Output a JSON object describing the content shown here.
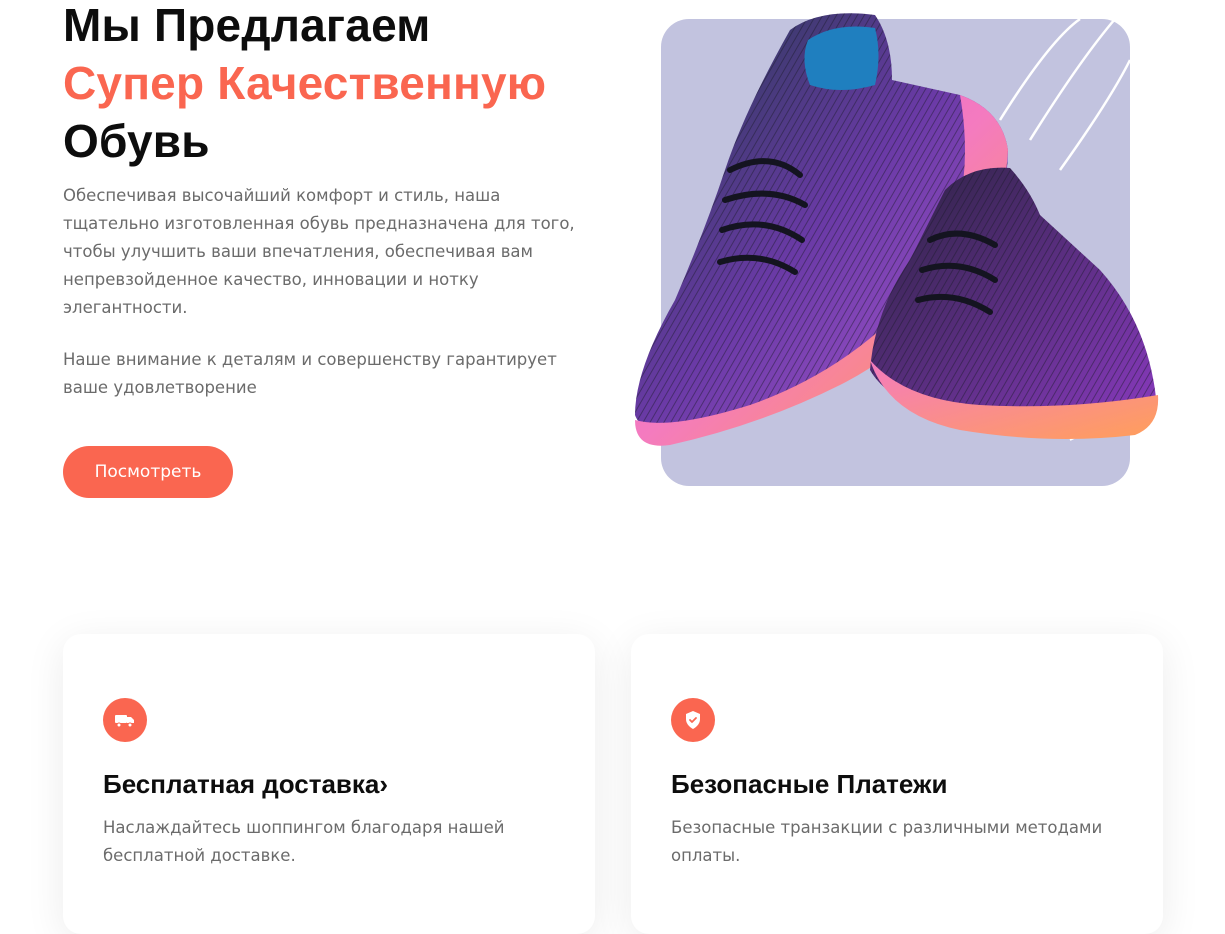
{
  "hero": {
    "title_line1": "Мы Предлагаем",
    "title_line2": "Супер Качественную",
    "title_line3": "Обувь",
    "paragraph1": "Обеспечивая высочайший комфорт и стиль, наша тщательно изготовленная обувь предназначена для того, чтобы улучшить ваши впечатления, обеспечивая вам непревзойденное качество, инновации и нотку элегантности.",
    "paragraph2": "Наше внимание к деталям и совершенству гарантирует ваше удовлетворение",
    "button_label": "Посмотреть",
    "image_icon": "sneakers-image"
  },
  "features": [
    {
      "icon": "delivery-truck-icon",
      "title": "Бесплатная доставка›",
      "text": "Наслаждайтесь шоппингом благодаря нашей бесплатной доставке."
    },
    {
      "icon": "shield-check-icon",
      "title": "Безопасные Платежи",
      "text": "Безопасные транзакции с различными методами оплаты."
    }
  ],
  "colors": {
    "accent": "#fa6650",
    "image_background": "#c2c3df",
    "heading": "#0d0d0d",
    "body_text": "#6b6b6b"
  }
}
